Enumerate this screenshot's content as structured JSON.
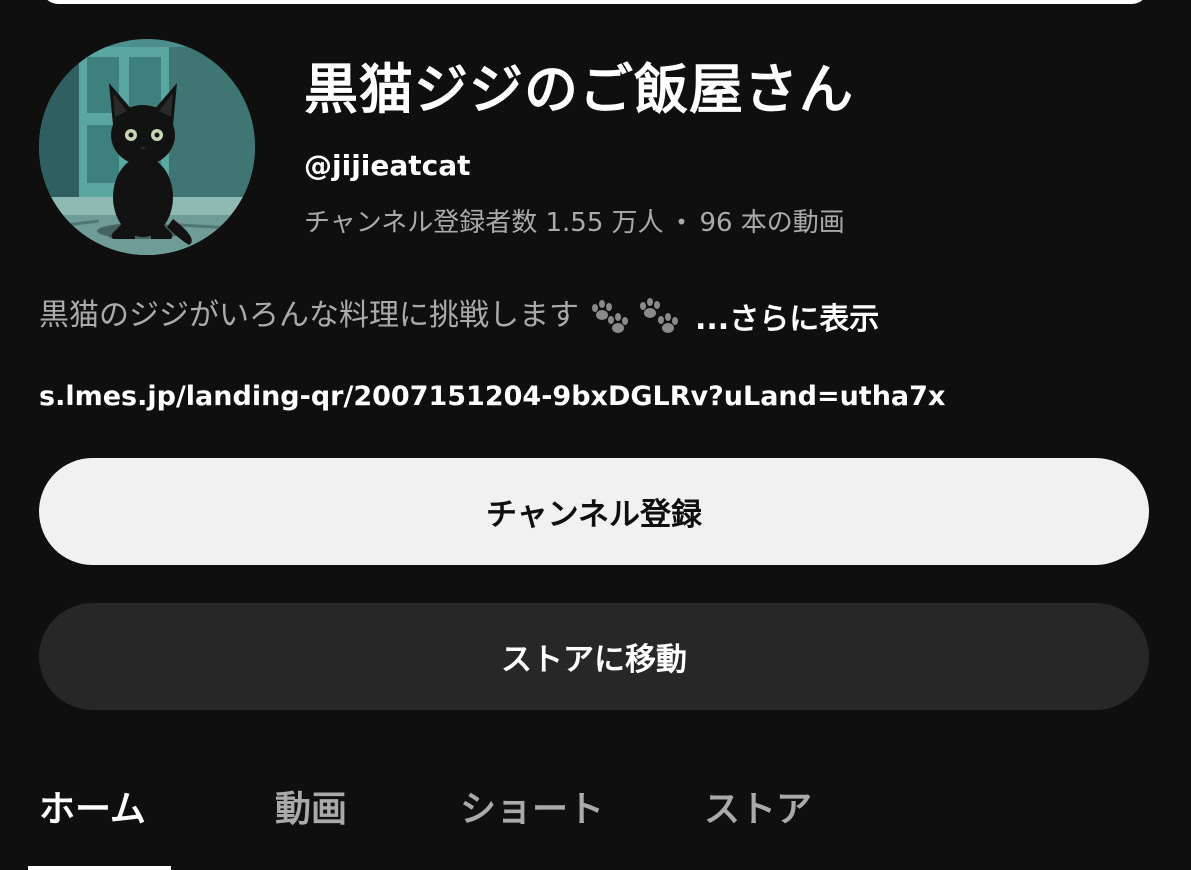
{
  "channel": {
    "name": "黒猫ジジのご飯屋さん",
    "handle": "@jijieatcat",
    "subscribers": "チャンネル登録者数 1.55 万人",
    "separator": "•",
    "videos": "96 本の動画",
    "description": "黒猫のジジがいろんな料理に挑戦します",
    "description_icons": [
      "paw-prints-icon",
      "paw-prints-icon"
    ],
    "more_label": "...さらに表示",
    "link": "s.lmes.jp/landing-qr/2007151204-9bxDGLRv?uLand=utha7x"
  },
  "buttons": {
    "subscribe": "チャンネル登録",
    "store": "ストアに移動"
  },
  "tabs": [
    {
      "label": "ホーム",
      "active": true
    },
    {
      "label": "動画",
      "active": false
    },
    {
      "label": "ショート",
      "active": false
    },
    {
      "label": "ストア",
      "active": false
    }
  ],
  "colors": {
    "background": "#0f0f0f",
    "primary_text": "#ffffff",
    "secondary_text": "#aaaaaa",
    "subscribe_bg": "#f1f1f1",
    "store_bg": "#272727"
  }
}
